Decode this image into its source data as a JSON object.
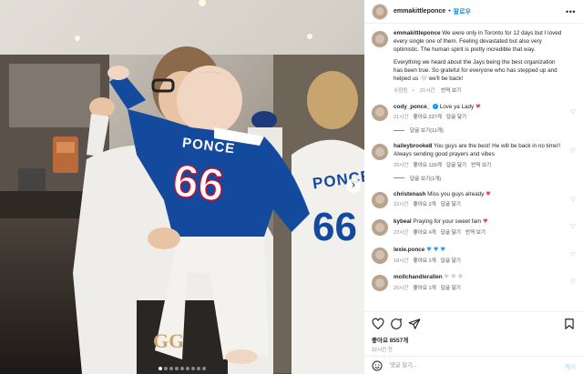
{
  "photo": {
    "jersey_name": "PONCE",
    "jersey_number": "66",
    "jersey_name_right": "PONCE",
    "jersey_number_right": "66",
    "dot_count": 9,
    "active_dot": 0,
    "next_icon": "chevron-right-icon"
  },
  "header": {
    "username": "emmakittleponce",
    "bullet": "•",
    "follow_label": "팔로우",
    "more_icon": "more-horizontal-icon"
  },
  "caption": {
    "username": "emmakittleponce",
    "text_p1": "We were only in Toronto for 12 days but I loved every single one of them. Feeling devastated but also very optimistic. The human spirit is pretty incredible that way.",
    "text_p2": "Everything we heard about the Jays being the best organization has been true. So grateful for everyone who has stepped up and helped us",
    "text_p2_heart": "🤍",
    "text_p2_end": "we'll be back!",
    "edited": "수정됨",
    "time": "21시간",
    "translate": "번역 보기"
  },
  "comments": [
    {
      "username": "cody_ponce_",
      "verified": true,
      "text": "Love ya Lady",
      "emoji": "♥",
      "emoji_style": "red",
      "time": "21시간",
      "likes": "좋아요 227개",
      "reply": "답글 달기",
      "replies": "답글 보기(11개)"
    },
    {
      "username": "haileybrooke8",
      "verified": false,
      "text": "You guys are the best! He will be back in no time!! Always sending good prayers and vibes",
      "emoji": "",
      "emoji_style": "",
      "time": "20시간",
      "likes": "좋아요 120개",
      "reply": "답글 달기",
      "translate": "번역 보기",
      "replies": "답글 보기(1개)"
    },
    {
      "username": "christenash",
      "verified": false,
      "text": "Miss you guys already",
      "emoji": "♥",
      "emoji_style": "red",
      "time": "22시간",
      "likes": "좋아요 2개",
      "reply": "답글 달기",
      "replies": ""
    },
    {
      "username": "kybeal",
      "verified": false,
      "text": "Praying for your sweet fam",
      "emoji": "♥",
      "emoji_style": "red",
      "time": "22시간",
      "likes": "좋아요 4개",
      "reply": "답글 달기",
      "translate": "번역 보기",
      "replies": ""
    },
    {
      "username": "lexie.ponce",
      "verified": false,
      "text": "",
      "emoji": "♥ ♥ ♥",
      "emoji_style": "blue",
      "time": "18시간",
      "likes": "좋아요 1개",
      "reply": "답글 달기",
      "replies": ""
    },
    {
      "username": "mollchandlerallen",
      "verified": false,
      "text": "",
      "emoji": "♥ ♥ ♥",
      "emoji_style": "light",
      "time": "20시간",
      "likes": "좋아요 1개",
      "reply": "답글 달기",
      "replies": ""
    }
  ],
  "actions": {
    "likes": "좋아요 8557개",
    "time": "22시간 전",
    "icons": [
      "heart-icon",
      "comment-icon",
      "share-icon",
      "bookmark-icon"
    ]
  },
  "add_comment": {
    "placeholder": "댓글 달기...",
    "post_label": "게시",
    "emoji_icon": "smile-icon"
  },
  "colors": {
    "accent": "#0095f6",
    "jersey_blue": "#134a9e",
    "text_primary": "#262626",
    "text_secondary": "#8e8e8e"
  }
}
